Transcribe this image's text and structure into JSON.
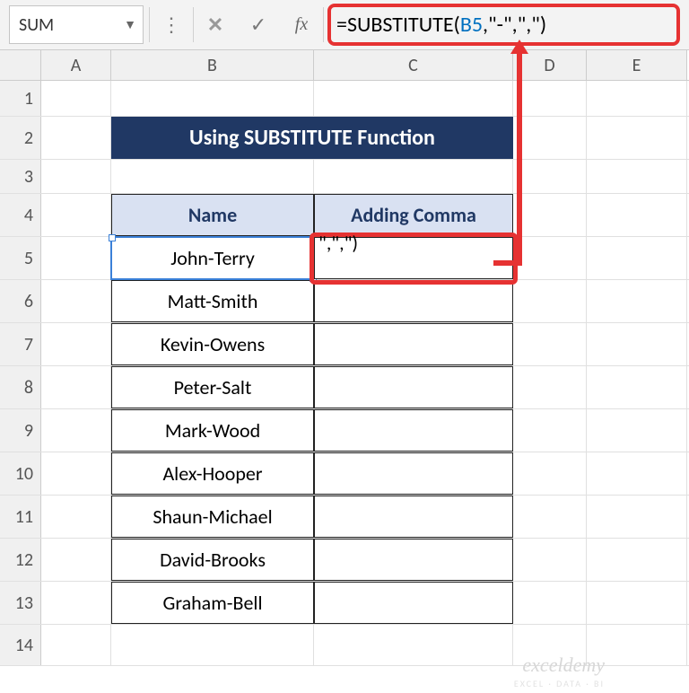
{
  "chart_data": {
    "type": "table",
    "title": "Using SUBSTITUTE Function",
    "columns": [
      "Name",
      "Adding Comma"
    ],
    "rows": [
      [
        "John-Terry",
        ""
      ],
      [
        "Matt-Smith",
        ""
      ],
      [
        "Kevin-Owens",
        ""
      ],
      [
        "Peter-Salt",
        ""
      ],
      [
        "Mark-Wood",
        ""
      ],
      [
        "Alex-Hooper",
        ""
      ],
      [
        "Shaun-Michael",
        ""
      ],
      [
        "David-Brooks",
        ""
      ],
      [
        "Graham-Bell",
        ""
      ]
    ]
  },
  "nameBox": {
    "value": "SUM"
  },
  "formula": {
    "prefix": "=SUBSTITUTE(",
    "ref": "B5",
    "suffix": ",\"-\",\",\")"
  },
  "columns": {
    "A": "A",
    "B": "B",
    "C": "C",
    "D": "D",
    "E": "E"
  },
  "rows": {
    "r1": "1",
    "r2": "2",
    "r3": "3",
    "r4": "4",
    "r5": "5",
    "r6": "6",
    "r7": "7",
    "r8": "8",
    "r9": "9",
    "r10": "10",
    "r11": "11",
    "r12": "12",
    "r13": "13",
    "r14": "14"
  },
  "title": "Using SUBSTITUTE Function",
  "headers": {
    "name": "Name",
    "adding": "Adding Comma"
  },
  "names": {
    "n5": "John-Terry",
    "n6": "Matt-Smith",
    "n7": "Kevin-Owens",
    "n8": "Peter-Salt",
    "n9": "Mark-Wood",
    "n10": "Alex-Hooper",
    "n11": "Shaun-Michael",
    "n12": "David-Brooks",
    "n13": "Graham-Bell"
  },
  "c5_display": "\",\",\")",
  "watermark": "exceldemy",
  "watermark_sub": "EXCEL · DATA · BI"
}
